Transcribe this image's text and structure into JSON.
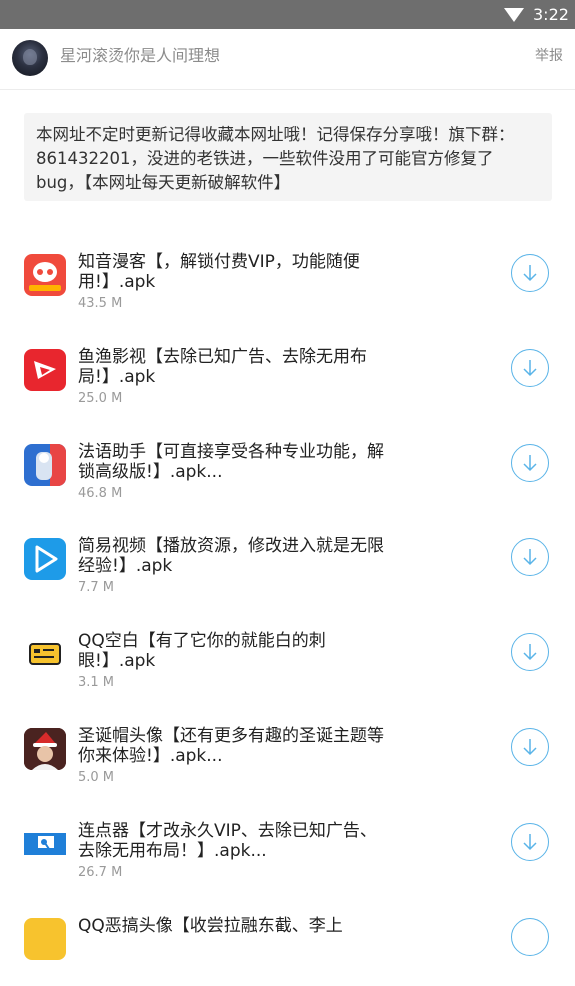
{
  "status_bar": {
    "time": "3:22"
  },
  "header": {
    "username": "星河滚烫你是人间理想",
    "report_label": "举报"
  },
  "notice": {
    "text": "本网址不定时更新记得收藏本网址哦！记得保存分享哦！旗下群：861432201，没进的老铁进，一些软件没用了可能官方修复了bug，【本网址每天更新破解软件】"
  },
  "apps": [
    {
      "title": "知音漫客【，解锁付费VIP，功能随便用!】.apk",
      "size": "43.5 M",
      "icon": "zhiyin-manke-icon"
    },
    {
      "title": "鱼渔影视【去除已知广告、去除无用布局!】.apk",
      "size": "25.0 M",
      "icon": "yuyu-video-icon"
    },
    {
      "title": "法语助手【可直接享受各种专业功能，解锁高级版!】.apk...",
      "size": "46.8 M",
      "icon": "french-assistant-icon"
    },
    {
      "title": "简易视频【播放资源，修改进入就是无限经验!】.apk",
      "size": "7.7 M",
      "icon": "play-video-icon"
    },
    {
      "title": "QQ空白【有了它你的就能白的刺眼!】.apk",
      "size": "3.1 M",
      "icon": "id-card-icon"
    },
    {
      "title": "圣诞帽头像【还有更多有趣的圣诞主题等你来体验!】.apk...",
      "size": "5.0 M",
      "icon": "christmas-avatar-icon"
    },
    {
      "title": "连点器【才改永久VIP、去除已知广告、去除无用布局！】.apk...",
      "size": "26.7 M",
      "icon": "auto-clicker-icon"
    }
  ],
  "partial_item_title": "QQ恶搞头像【收尝拉融东截、李上",
  "colors": {
    "accent": "#5ab4e8",
    "status_bar": "#6e6e6e"
  }
}
